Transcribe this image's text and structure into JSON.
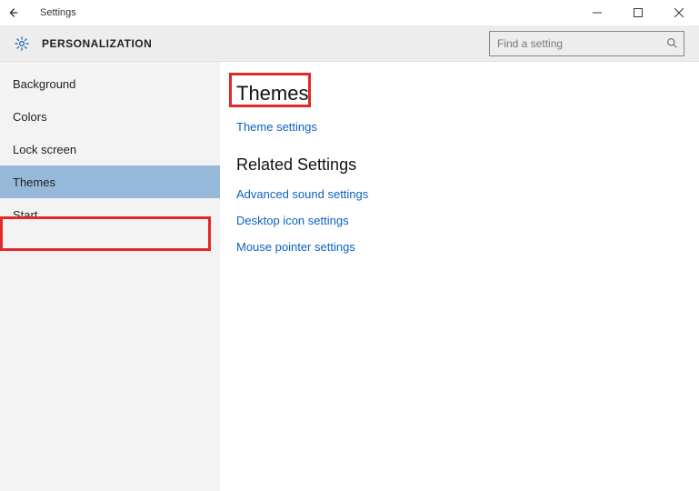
{
  "titlebar": {
    "title": "Settings"
  },
  "header": {
    "section": "PERSONALIZATION",
    "search_placeholder": "Find a setting"
  },
  "sidebar": {
    "items": [
      {
        "label": "Background",
        "selected": false
      },
      {
        "label": "Colors",
        "selected": false
      },
      {
        "label": "Lock screen",
        "selected": false
      },
      {
        "label": "Themes",
        "selected": true
      },
      {
        "label": "Start",
        "selected": false
      }
    ]
  },
  "content": {
    "heading": "Themes",
    "primary_link": "Theme settings",
    "related_heading": "Related Settings",
    "related_links": [
      "Advanced sound settings",
      "Desktop icon settings",
      "Mouse pointer settings"
    ]
  }
}
